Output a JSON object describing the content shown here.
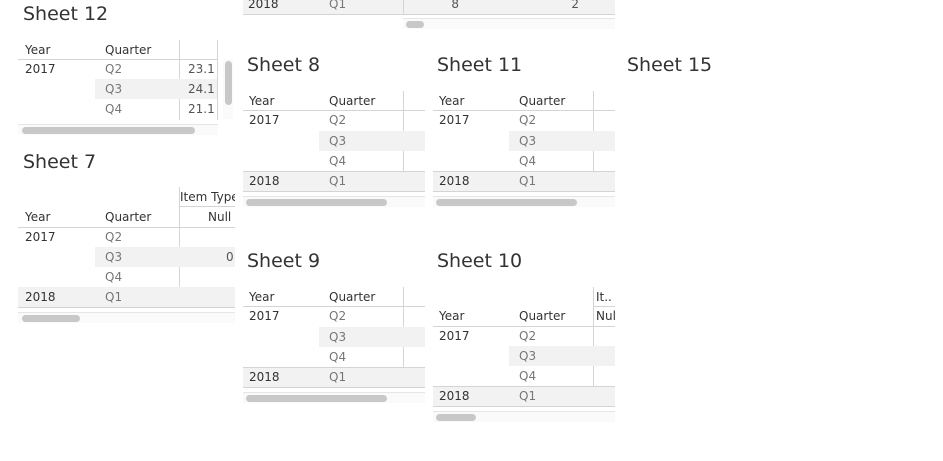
{
  "headers": {
    "year": "Year",
    "quarter": "Quarter",
    "item_type": "Item Type",
    "item_short": "It..",
    "null": "Null",
    "null_short": "Nul"
  },
  "years": {
    "y2017": "2017",
    "y2018": "2018"
  },
  "quarters": {
    "q1": "Q1",
    "q2": "Q2",
    "q3": "Q3",
    "q4": "Q4"
  },
  "sheets": {
    "s12": {
      "title": "Sheet 12",
      "values": [
        "23.1",
        "24.1",
        "21.1"
      ]
    },
    "s7": {
      "title": "Sheet 7",
      "q3_value": "0"
    },
    "s8": {
      "title": "Sheet 8"
    },
    "s11": {
      "title": "Sheet 11"
    },
    "s15": {
      "title": "Sheet 15"
    },
    "s9": {
      "title": "Sheet 9"
    },
    "s10": {
      "title": "Sheet 10"
    },
    "top": {
      "val_a": "8",
      "val_b": "2"
    }
  }
}
